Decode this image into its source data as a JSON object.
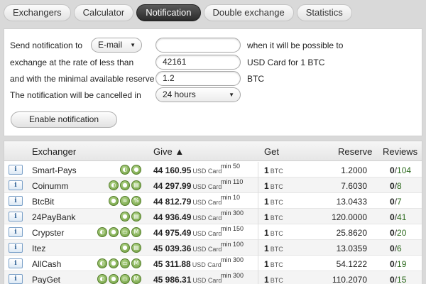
{
  "tabs": [
    {
      "label": "Exchangers",
      "active": false
    },
    {
      "label": "Calculator",
      "active": false
    },
    {
      "label": "Notification",
      "active": true
    },
    {
      "label": "Double exchange",
      "active": false
    },
    {
      "label": "Statistics",
      "active": false
    }
  ],
  "form": {
    "send_label": "Send notification to",
    "send_method": "E-mail",
    "contact_value": "",
    "send_note": "when it will be possible to",
    "rate_label": "exchange at the rate of less than",
    "rate_value": "42161",
    "rate_note": "USD Card for 1 BTC",
    "reserve_label": "and with the minimal available reserve of",
    "reserve_value": "1.2",
    "reserve_note": "BTC",
    "cancel_label": "The notification will be cancelled in",
    "cancel_value": "24 hours",
    "enable_button": "Enable notification"
  },
  "table": {
    "headers": {
      "exchanger": "Exchanger",
      "give": "Give ▲",
      "get": "Get",
      "reserve": "Reserve",
      "reviews": "Reviews"
    },
    "info_glyph": "i",
    "rows": [
      {
        "name": "Smart-Pays",
        "badges": [
          "hand",
          "lock"
        ],
        "give_amount": "44 160.95",
        "give_currency": "USD Card",
        "min": "min 50",
        "get_amount": "1",
        "get_currency": "BTC",
        "reserve": "1.2000",
        "reviews_neg": "0",
        "reviews_pos": "104"
      },
      {
        "name": "Coinumm",
        "badges": [
          "hand",
          "lock",
          "doc"
        ],
        "give_amount": "44 297.99",
        "give_currency": "USD Card",
        "min": "min 110",
        "get_amount": "1",
        "get_currency": "BTC",
        "reserve": "7.6030",
        "reviews_neg": "0",
        "reviews_pos": "8"
      },
      {
        "name": "BtcBit",
        "badges": [
          "lock",
          "link",
          "percent"
        ],
        "give_amount": "44 812.79",
        "give_currency": "USD Card",
        "min": "min 10",
        "get_amount": "1",
        "get_currency": "BTC",
        "reserve": "13.0433",
        "reviews_neg": "0",
        "reviews_pos": "7"
      },
      {
        "name": "24PayBank",
        "badges": [
          "lock",
          "doc"
        ],
        "give_amount": "44 936.49",
        "give_currency": "USD Card",
        "min": "min 300",
        "get_amount": "1",
        "get_currency": "BTC",
        "reserve": "120.0000",
        "reviews_neg": "0",
        "reviews_pos": "41"
      },
      {
        "name": "Crypster",
        "badges": [
          "hand",
          "lock",
          "card",
          "m"
        ],
        "give_amount": "44 975.49",
        "give_currency": "USD Card",
        "min": "min 150",
        "get_amount": "1",
        "get_currency": "BTC",
        "reserve": "25.8620",
        "reviews_neg": "0",
        "reviews_pos": "20"
      },
      {
        "name": "Itez",
        "badges": [
          "lock",
          "doc"
        ],
        "give_amount": "45 039.36",
        "give_currency": "USD Card",
        "min": "min 100",
        "get_amount": "1",
        "get_currency": "BTC",
        "reserve": "13.0359",
        "reviews_neg": "0",
        "reviews_pos": "6"
      },
      {
        "name": "AllCash",
        "badges": [
          "hand",
          "lock",
          "card",
          "m"
        ],
        "give_amount": "45 311.88",
        "give_currency": "USD Card",
        "min": "min 300",
        "get_amount": "1",
        "get_currency": "BTC",
        "reserve": "54.1222",
        "reviews_neg": "0",
        "reviews_pos": "19"
      },
      {
        "name": "PayGet",
        "badges": [
          "hand",
          "lock",
          "card",
          "m"
        ],
        "give_amount": "45 986.31",
        "give_currency": "USD Card",
        "min": "min 300",
        "get_amount": "1",
        "get_currency": "BTC",
        "reserve": "110.2070",
        "reviews_neg": "0",
        "reviews_pos": "15"
      }
    ]
  }
}
